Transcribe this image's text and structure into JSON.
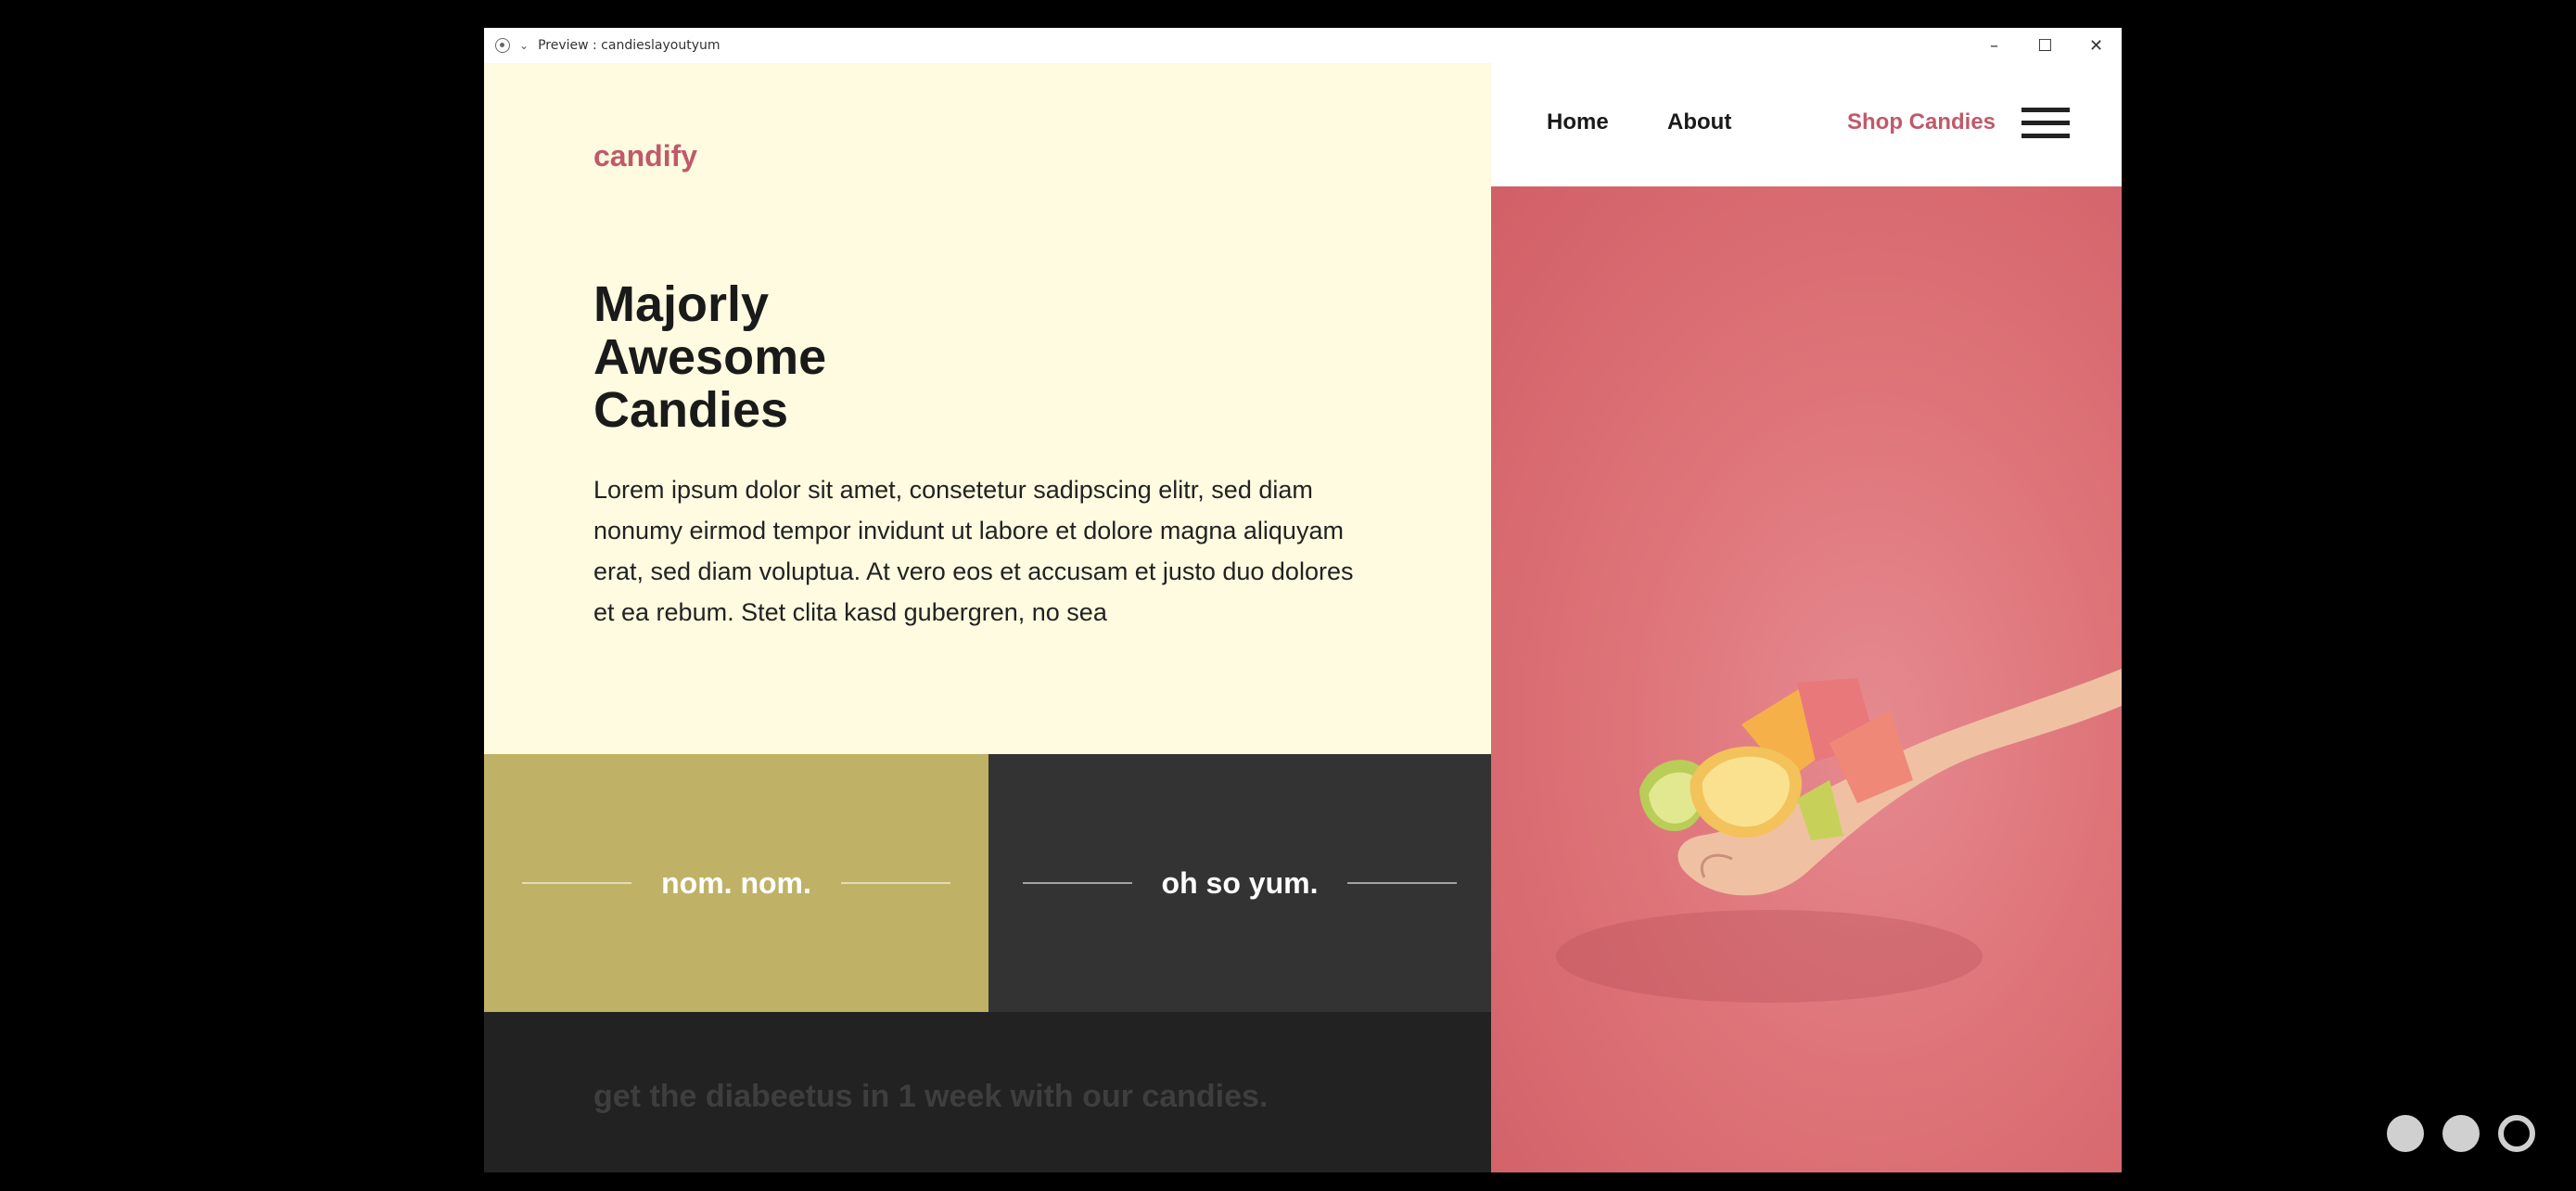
{
  "window": {
    "title": "Preview : candieslayoutyum",
    "controls": [
      "–",
      "☐",
      "✕"
    ]
  },
  "site": {
    "logo": "candify",
    "headline": [
      "Majorly",
      "Awesome",
      "Candies"
    ],
    "body": "Lorem ipsum dolor sit amet, consetetur sadipscing elitr, sed diam nonumy eirmod tempor invidunt ut labore et dolore magna aliquyam erat, sed diam voluptua. At vero eos et accusam et justo duo dolores et ea rebum. Stet clita kasd gubergren, no sea",
    "tiles": [
      {
        "label": "nom. nom.",
        "color": "#bfb266"
      },
      {
        "label": "oh so yum.",
        "color": "#333333"
      }
    ],
    "tagline": "get the diabeetus in 1 week with our candies.",
    "nav": {
      "home": "Home",
      "about": "About",
      "shop": "Shop Candies",
      "menu_icon": "hamburger-menu-icon"
    },
    "accent_color": "#c0596a",
    "background_color": "#fffbe0",
    "photo_description_icon": "candy-hand-image"
  },
  "pager": {
    "dots": 3,
    "active_index": 2
  }
}
